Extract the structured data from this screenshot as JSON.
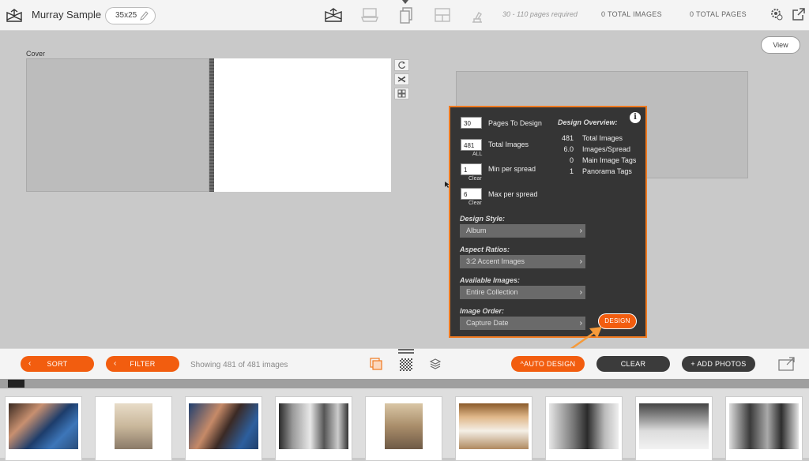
{
  "header": {
    "project_title": "Murray Sample",
    "album_size": "35x25",
    "pages_required": "30 - 110 pages required",
    "total_images": "0  TOTAL IMAGES",
    "total_pages": "0  TOTAL PAGES",
    "nav_icons": [
      "album-icon",
      "layout-icon",
      "pages-icon",
      "spread-icon",
      "proof-icon"
    ],
    "right_icons": [
      "settings-icon",
      "share-icon"
    ]
  },
  "canvas": {
    "cover_label": "Cover",
    "view_label": "View",
    "spread_tools": [
      "refresh-icon",
      "shuffle-icon",
      "grid-icon"
    ]
  },
  "design_panel": {
    "pages_to_design": {
      "value": "30",
      "label": "Pages To Design"
    },
    "total_images": {
      "value": "481",
      "label": "Total Images",
      "sub": "ALL"
    },
    "min_per_spread": {
      "value": "1",
      "label": "Min per spread",
      "sub": "Clear"
    },
    "max_per_spread": {
      "value": "6",
      "label": "Max per spread",
      "sub": "Clear"
    },
    "overview_title": "Design Overview:",
    "overview": [
      {
        "value": "481",
        "label": "Total Images"
      },
      {
        "value": "6.0",
        "label": "Images/Spread"
      },
      {
        "value": "0",
        "label": "Main Image Tags"
      },
      {
        "value": "1",
        "label": "Panorama Tags"
      }
    ],
    "design_style": {
      "label": "Design Style:",
      "value": "Album"
    },
    "aspect_ratios": {
      "label": "Aspect Ratios:",
      "value": "3:2 Accent Images"
    },
    "available_images": {
      "label": "Available Images:",
      "value": "Entire Collection"
    },
    "image_order": {
      "label": "Image Order:",
      "value": "Capture Date"
    },
    "design_button": "DESIGN",
    "info_glyph": "i",
    "accent_color": "#f07a20"
  },
  "toolbar": {
    "sort_label": "SORT",
    "filter_label": "FILTER",
    "showing_text": "Showing 481 of 481 images",
    "auto_design_label": "^AUTO DESIGN",
    "clear_label": "CLEAR",
    "add_photos_label": "+ ADD PHOTOS",
    "center_icons": [
      "stack-icon",
      "checker-icon",
      "layers-icon"
    ]
  },
  "filmstrip": {
    "photos": [
      "bride-makeup",
      "bride-dress-detail",
      "bride-makeup-close",
      "bw-bride-window",
      "wedding-shoes",
      "wedding-dress-hanging",
      "bw-bride-seated",
      "bw-bride-bed",
      "bw-bride-mother"
    ]
  },
  "colors": {
    "orange": "#f25d0f",
    "dark_button": "#3b3b3b",
    "panel_bg": "#353535"
  }
}
